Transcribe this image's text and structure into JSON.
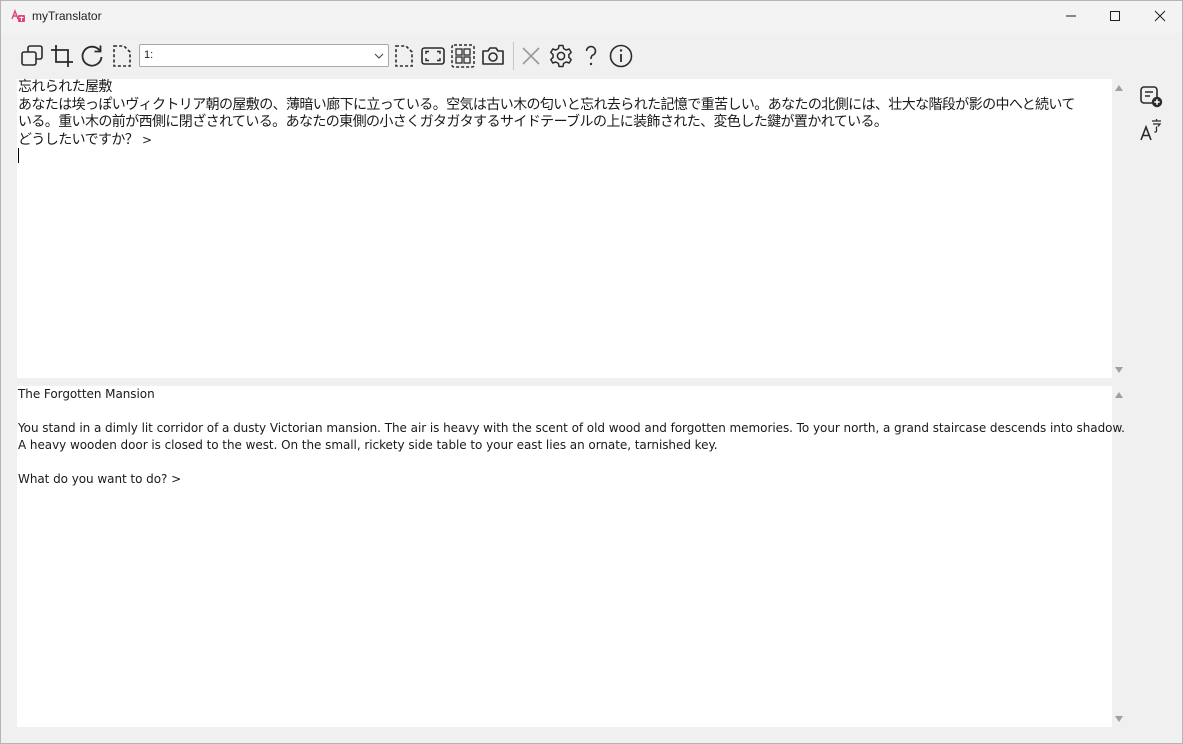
{
  "window": {
    "title": "myTranslator"
  },
  "toolbar": {
    "combo_value": "1:",
    "icons": [
      "copy-window-icon",
      "crop-icon",
      "refresh-icon",
      "region-select-icon",
      "region-start-icon",
      "full-screen-icon",
      "multi-region-icon",
      "camera-icon",
      "close-icon",
      "gear-icon",
      "help-icon",
      "info-icon"
    ]
  },
  "source_pane": {
    "lines": [
      "忘れられた屋敷",
      "あなたは埃っぽいヴィクトリア朝の屋敷の、薄暗い廊下に立っている。空気は古い木の匂いと忘れ去られた記憶で重苦しい。あなたの北側には、壮大な階段が影の中へと続いて",
      "いる。重い木の前が西側に閉ざされている。あなたの東側の小さくガタガタするサイドテーブルの上に装飾された、変色した鍵が置かれている。"
    ],
    "prompt": "どうしたいですか？",
    "prompt_suffix": ">"
  },
  "translation_pane": {
    "lines": [
      "The Forgotten Mansion",
      "",
      "You stand in a dimly lit corridor of a dusty Victorian mansion. The air is heavy with the scent of old wood and forgotten memories. To your north, a grand staircase descends into shadow.",
      "A heavy wooden door is closed to the west. On the small, rickety side table to your east lies an ornate, tarnished key.",
      "",
      "What do you want to do? >"
    ]
  },
  "side_buttons": [
    "add-note-icon",
    "translate-font-icon"
  ],
  "colors": {
    "window_bg": "#f0f0f0",
    "pane_bg": "#ffffff",
    "icon": "#2b2b2b",
    "disabled_icon": "#9a9a9a",
    "app_icon": "#e0457b"
  }
}
